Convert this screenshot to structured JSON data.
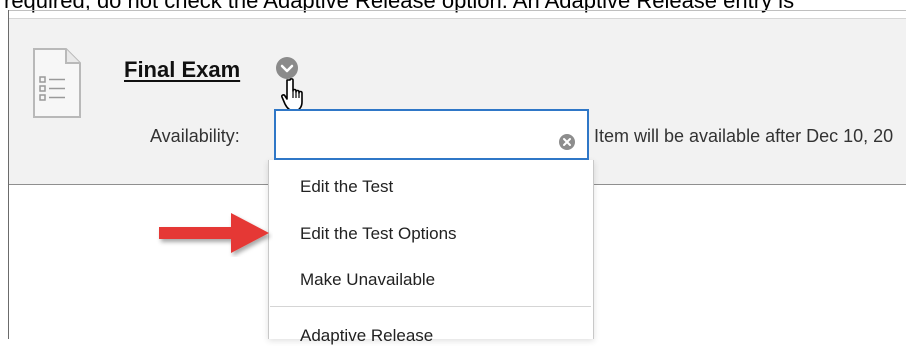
{
  "top_text": "required, do not check the Adaptive Release option. An Adaptive Release entry is",
  "test": {
    "title": "Final Exam",
    "availability_label": "Availability:",
    "availability_value": "Item will be available after Dec 10, 20"
  },
  "menu": {
    "search_value": "",
    "items": [
      {
        "label": "Edit the Test"
      },
      {
        "label": "Edit the Test Options"
      },
      {
        "label": "Make Unavailable"
      },
      {
        "label": "Adaptive Release"
      }
    ]
  },
  "colors": {
    "row_bg": "#f2f2f2",
    "search_border": "#2f77c7",
    "arrow": "#e53935"
  },
  "icons": {
    "test": "test-document-icon",
    "chevron": "chevron-down-icon",
    "cursor": "hand-cursor-icon",
    "clear": "clear-circle-icon",
    "arrow": "red-arrow-icon"
  }
}
